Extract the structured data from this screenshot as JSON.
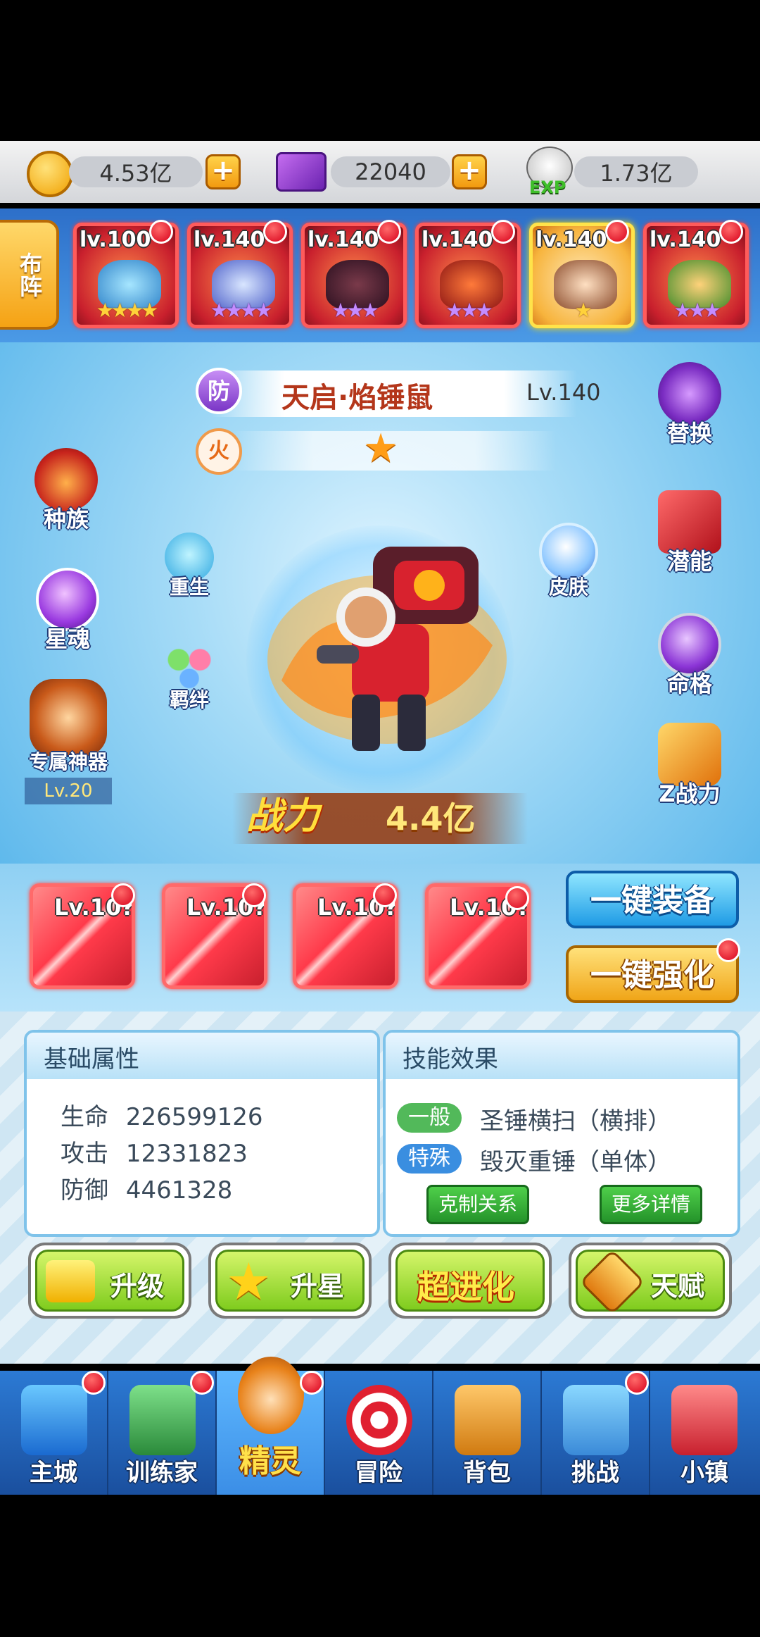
{
  "currency": {
    "gold": "4.53亿",
    "gems": "22040",
    "exp": "1.73亿",
    "exp_label": "EXP"
  },
  "team": {
    "buzhen_label": "布阵",
    "slots": [
      {
        "level": "lv.100",
        "stars": "★★★★",
        "star_color": "gold"
      },
      {
        "level": "lv.140",
        "stars": "★★★★",
        "star_color": "purple"
      },
      {
        "level": "lv.140",
        "stars": "★★★",
        "star_color": "purple"
      },
      {
        "level": "lv.140",
        "stars": "★★★",
        "star_color": "purple"
      },
      {
        "level": "lv.140",
        "stars": "★",
        "star_color": "gold"
      },
      {
        "level": "lv.140",
        "stars": "★★★",
        "star_color": "purple"
      }
    ]
  },
  "hero": {
    "type_badge": "防",
    "element_badge": "火",
    "name": "天启·焰锤鼠",
    "level": "Lv.140",
    "power_label": "战力",
    "power_value": "4.4亿"
  },
  "left_buttons": {
    "race": "种族",
    "rebirth": "重生",
    "star_soul": "星魂",
    "bond": "羁绊",
    "artifact": "专属神器",
    "artifact_level": "Lv.20"
  },
  "right_buttons": {
    "swap": "替换",
    "potential": "潜能",
    "skin": "皮肤",
    "fate": "命格",
    "z_power": "Z战力"
  },
  "equipment": {
    "items": [
      {
        "level": "Lv.10?"
      },
      {
        "level": "Lv.10?"
      },
      {
        "level": "Lv.10?"
      },
      {
        "level": "Lv.10?"
      }
    ],
    "equip_all": "一键装备",
    "enhance_all": "一键强化"
  },
  "attributes": {
    "title": "基础属性",
    "rows": [
      {
        "label": "生命",
        "value": "226599126"
      },
      {
        "label": "攻击",
        "value": "12331823"
      },
      {
        "label": "防御",
        "value": "4461328"
      }
    ]
  },
  "skills": {
    "title": "技能效果",
    "rows": [
      {
        "tag": "一般",
        "name": "圣锤横扫（横排）"
      },
      {
        "tag": "特殊",
        "name": "毁灭重锤（单体）"
      }
    ],
    "counter_btn": "克制关系",
    "detail_btn": "更多详情"
  },
  "actions": {
    "upgrade": "升级",
    "star_up": "升星",
    "evolve": "超进化",
    "talent": "天赋"
  },
  "nav": {
    "items": [
      "主城",
      "训练家",
      "精灵",
      "冒险",
      "背包",
      "挑战",
      "小镇"
    ],
    "active_index": 2
  },
  "colors": {
    "accent_red": "#d8001a",
    "team_bg": "#2d6fc9",
    "nav_bg": "#1a4f9e"
  }
}
